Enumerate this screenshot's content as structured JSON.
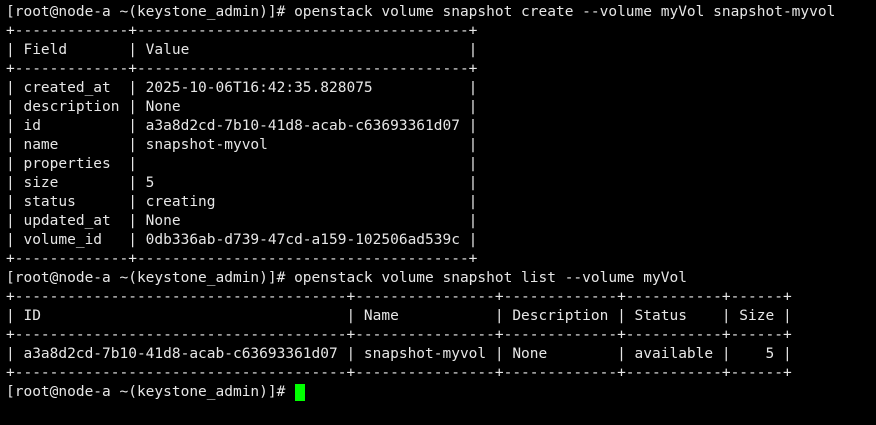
{
  "terminal": {
    "background": "#000000",
    "foreground": "#e6e6e6",
    "cursor_color": "#00ff00",
    "lines": [
      "[root@node-a ~(keystone_admin)]# openstack volume snapshot create --volume myVol snapshot-myvol",
      "+-------------+--------------------------------------+",
      "| Field       | Value                                |",
      "+-------------+--------------------------------------+",
      "| created_at  | 2025-10-06T16:42:35.828075           |",
      "| description | None                                 |",
      "| id          | a3a8d2cd-7b10-41d8-acab-c63693361d07 |",
      "| name        | snapshot-myvol                       |",
      "| properties  |                                      |",
      "| size        | 5                                    |",
      "| status      | creating                             |",
      "| updated_at  | None                                 |",
      "| volume_id   | 0db336ab-d739-47cd-a159-102506ad539c |",
      "+-------------+--------------------------------------+",
      "[root@node-a ~(keystone_admin)]# openstack volume snapshot list --volume myVol",
      "+--------------------------------------+----------------+-------------+-----------+------+",
      "| ID                                   | Name           | Description | Status    | Size |",
      "+--------------------------------------+----------------+-------------+-----------+------+",
      "| a3a8d2cd-7b10-41d8-acab-c63693361d07 | snapshot-myvol | None        | available |    5 |",
      "+--------------------------------------+----------------+-------------+-----------+------+"
    ],
    "current_prompt": "[root@node-a ~(keystone_admin)]# "
  }
}
